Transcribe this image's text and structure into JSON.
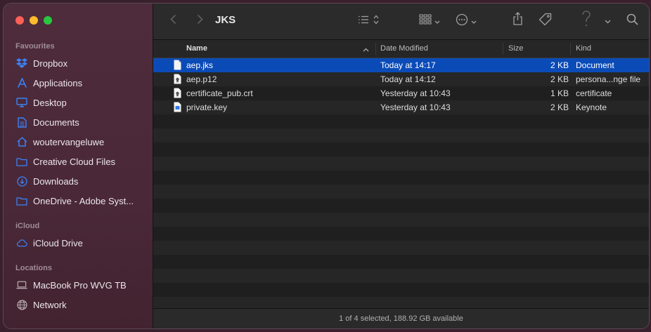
{
  "window": {
    "title": "JKS"
  },
  "sidebar": {
    "favourites_title": "Favourites",
    "icloud_title": "iCloud",
    "locations_title": "Locations",
    "favourites": [
      {
        "label": "Dropbox",
        "icon": "dropbox-icon"
      },
      {
        "label": "Applications",
        "icon": "applications-icon"
      },
      {
        "label": "Desktop",
        "icon": "desktop-icon"
      },
      {
        "label": "Documents",
        "icon": "document-icon"
      },
      {
        "label": "woutervangeluwe",
        "icon": "home-icon"
      },
      {
        "label": "Creative Cloud Files",
        "icon": "folder-icon"
      },
      {
        "label": "Downloads",
        "icon": "download-icon"
      },
      {
        "label": "OneDrive - Adobe Syst...",
        "icon": "folder-icon"
      }
    ],
    "icloud": [
      {
        "label": "iCloud Drive",
        "icon": "cloud-icon"
      }
    ],
    "locations": [
      {
        "label": "MacBook Pro WVG TB",
        "icon": "laptop-icon"
      },
      {
        "label": "Network",
        "icon": "globe-icon"
      }
    ]
  },
  "columns": {
    "name": "Name",
    "date": "Date Modified",
    "size": "Size",
    "kind": "Kind"
  },
  "files": [
    {
      "name": "aep.jks",
      "date": "Today at 14:17",
      "size": "2 KB",
      "kind": "Document",
      "selected": true
    },
    {
      "name": "aep.p12",
      "date": "Today at 14:12",
      "size": "2 KB",
      "kind": "persona...nge file",
      "selected": false
    },
    {
      "name": "certificate_pub.crt",
      "date": "Yesterday at 10:43",
      "size": "1 KB",
      "kind": "certificate",
      "selected": false
    },
    {
      "name": "private.key",
      "date": "Yesterday at 10:43",
      "size": "2 KB",
      "kind": "Keynote",
      "selected": false
    }
  ],
  "status": {
    "text": "1 of 4 selected, 188.92 GB available"
  },
  "colors": {
    "accent": "#3b82f6",
    "selection": "#0b4bb8"
  }
}
